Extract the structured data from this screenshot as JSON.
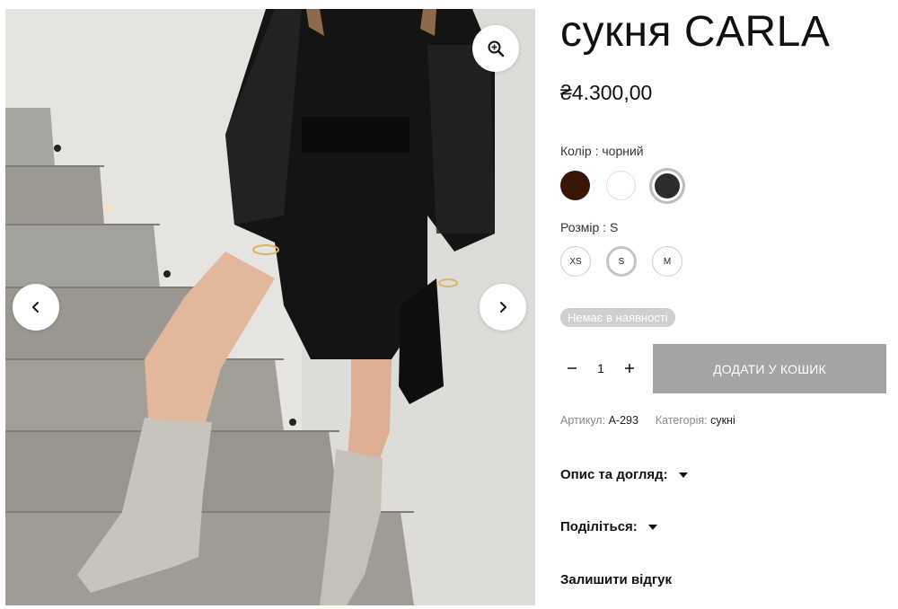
{
  "product": {
    "title": "сукня CARLA",
    "price": "₴4.300,00",
    "color_label": "Колір : чорний",
    "colors": [
      {
        "name": "brown",
        "hex": "#3b1408"
      },
      {
        "name": "white",
        "hex": "#ffffff"
      },
      {
        "name": "black",
        "hex": "#2c2c2c",
        "selected": true
      }
    ],
    "size_label": "Розмір : S",
    "sizes": [
      {
        "label": "XS"
      },
      {
        "label": "S",
        "selected": true
      },
      {
        "label": "M"
      }
    ],
    "stock_badge": "Немає в наявності",
    "quantity": "1",
    "add_to_cart": "ДОДАТИ У КОШИК",
    "sku_label": "Артикул:",
    "sku_value": "A-293",
    "category_label": "Категорія:",
    "category_value": "сукні"
  },
  "accordion": {
    "description": "Опис та догляд:",
    "share": "Поділіться:",
    "review": "Залишити відгук"
  },
  "icons": {
    "zoom": "magnifier-plus-icon",
    "prev": "chevron-left-icon",
    "next": "chevron-right-icon",
    "minus": "minus-icon",
    "plus": "plus-icon",
    "caret": "caret-down-icon"
  },
  "colors": {
    "button_disabled": "#a4a4a4",
    "badge": "#cfcfcf"
  }
}
